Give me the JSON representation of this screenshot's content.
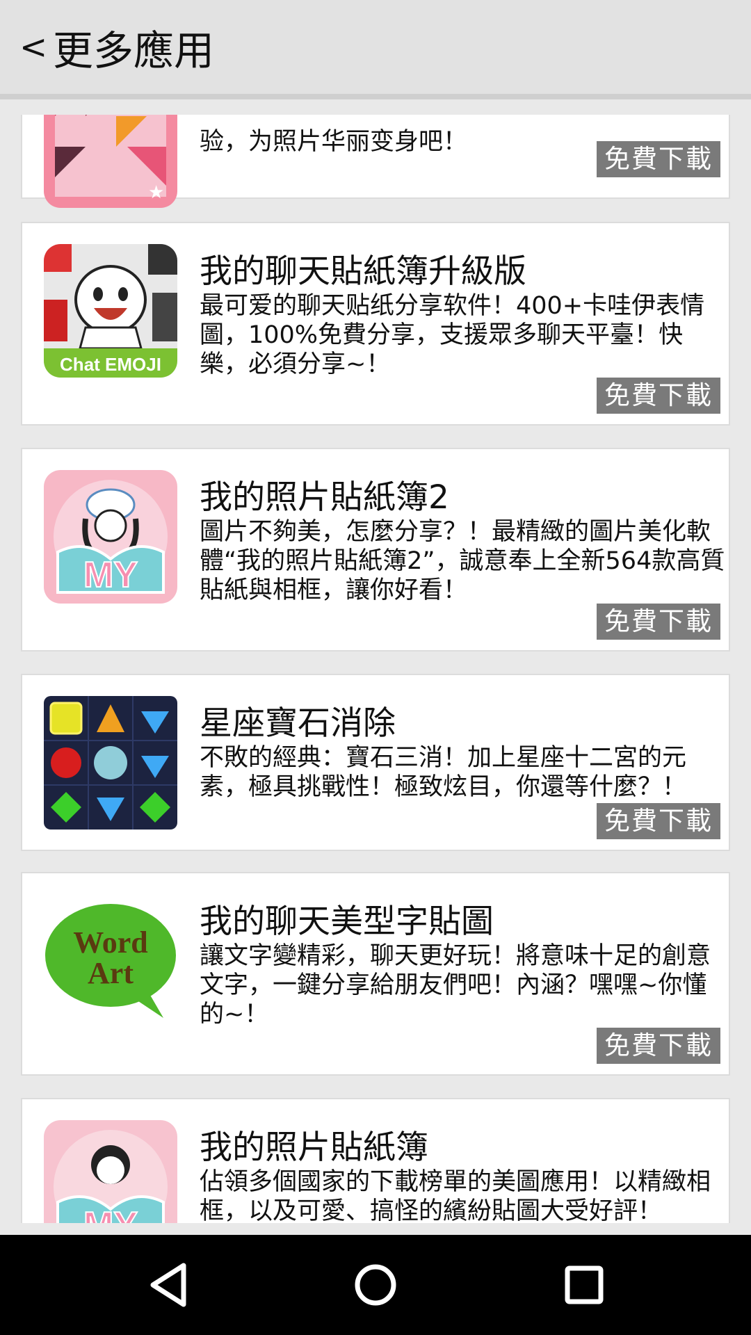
{
  "header": {
    "back": "<",
    "title": "更多應用"
  },
  "download_label": "免費下載",
  "apps": [
    {
      "name": "",
      "desc": "验，为照片华丽变身吧！"
    },
    {
      "name": "我的聊天貼紙簿升級版",
      "desc": "最可爱的聊天贴纸分享软件！400+卡哇伊表情圖，100%免費分享，支援眾多聊天平臺！快樂，必須分享~！",
      "icon_text": "Chat EMOJI"
    },
    {
      "name": "我的照片貼紙簿2",
      "desc": "圖片不夠美，怎麼分享？！最精緻的圖片美化軟體“我的照片貼紙簿2”，誠意奉上全新564款高質貼紙與相框，讓你好看！",
      "icon_text": "MY"
    },
    {
      "name": "星座寶石消除",
      "desc": "不敗的經典：寶石三消！加上星座十二宮的元素，極具挑戰性！極致炫目，你還等什麼？！"
    },
    {
      "name": "我的聊天美型字貼圖",
      "desc": "讓文字變精彩，聊天更好玩！將意味十足的創意文字，一鍵分享給朋友們吧！內涵？嘿嘿~你懂的~！",
      "icon_text": "Word Art"
    },
    {
      "name": "我的照片貼紙簿",
      "desc": "佔領多個國家的下載榜單的美圖應用！以精緻相框，以及可愛、搞怪的繽紛貼圖大受好評！",
      "icon_text": "MY"
    }
  ],
  "colors": {
    "button": "#7a7a7a",
    "header": "#e2e2e2",
    "background": "#e9e9e9"
  }
}
